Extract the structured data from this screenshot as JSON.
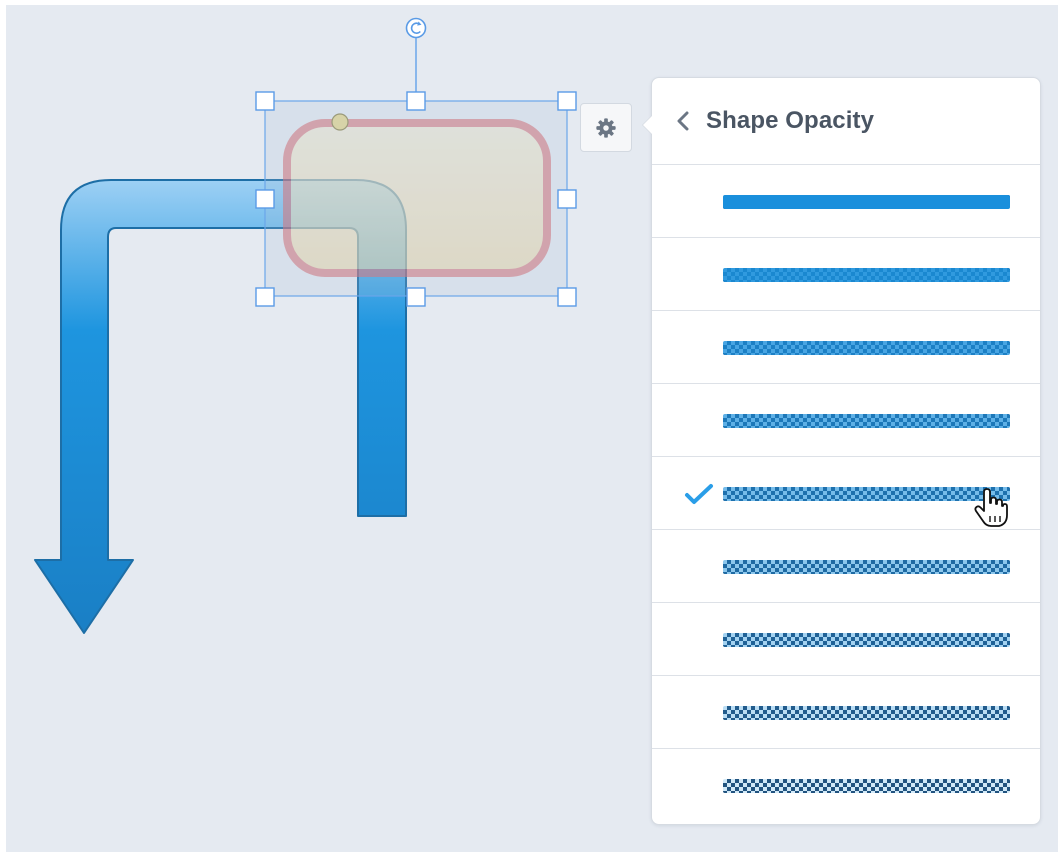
{
  "panel": {
    "title": "Shape Opacity",
    "back_icon": "chevron-left-icon",
    "selected_index": 4,
    "options": [
      {
        "opacity": 1.0
      },
      {
        "opacity": 0.9
      },
      {
        "opacity": 0.8
      },
      {
        "opacity": 0.7
      },
      {
        "opacity": 0.6
      },
      {
        "opacity": 0.5
      },
      {
        "opacity": 0.4
      },
      {
        "opacity": 0.3
      },
      {
        "opacity": 0.2
      }
    ]
  },
  "toolbar": {
    "settings_icon": "gear-icon"
  },
  "canvas": {
    "shapes": [
      {
        "kind": "bent-arrow",
        "fill": "#1a8fdc",
        "stroke": "#1d6ea6"
      },
      {
        "kind": "rounded-rectangle",
        "fill": "#f0dba0",
        "stroke": "#e0888a",
        "opacity": 0.6
      }
    ],
    "selection": {
      "handles": 8,
      "rotate_icon": "rotate-icon"
    }
  },
  "colors": {
    "canvas_bg": "#e5eaf1",
    "accent": "#1a8fdc",
    "check": "#2a9ee8",
    "selection": "#6aa6ea"
  }
}
